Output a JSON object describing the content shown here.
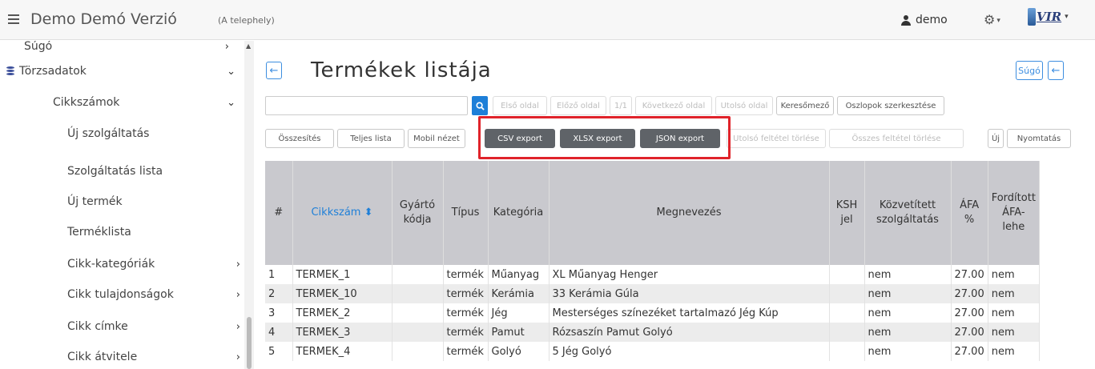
{
  "topbar": {
    "title": "Demo Demó Verzió",
    "subtitle": "(A telephely)",
    "user": "demo",
    "logo_text": "VIR"
  },
  "sidebar": {
    "items": [
      {
        "label": "Súgó"
      },
      {
        "label": "Törzsadatok"
      },
      {
        "label": "Cikkszámok"
      },
      {
        "label": "Új szolgáltatás"
      },
      {
        "label": "Szolgáltatás lista"
      },
      {
        "label": "Új termék"
      },
      {
        "label": "Terméklista"
      },
      {
        "label": "Cikk-kategóriák"
      },
      {
        "label": "Cikk tulajdonságok"
      },
      {
        "label": "Cikk címke"
      },
      {
        "label": "Cikk átvitele"
      }
    ]
  },
  "page": {
    "title": "Termékek listája",
    "help_label": "Súgó"
  },
  "search": {
    "value": "",
    "placeholder": ""
  },
  "toolbar_row1": {
    "first": "Első oldal",
    "prev": "Előző oldal",
    "page": "1/1",
    "next": "Következő oldal",
    "last": "Utolsó oldal",
    "search_field": "Keresőmező",
    "edit_columns": "Oszlopok szerkesztése"
  },
  "toolbar_row2": {
    "summary": "Összesítés",
    "full_list": "Teljes lista",
    "mobile": "Mobil nézet",
    "csv": "CSV export",
    "xlsx": "XLSX export",
    "json": "JSON export",
    "clear_last": "Utolsó feltétel törlése",
    "clear_all": "Összes feltétel törlése",
    "new": "Új",
    "print": "Nyomtatás"
  },
  "table": {
    "headers": {
      "num": "#",
      "code": "Cikkszám",
      "maker": "Gyártó kódja",
      "type": "Típus",
      "category": "Kategória",
      "name": "Megnevezés",
      "ksh": "KSH jel",
      "mediated": "Közvetített szolgáltatás",
      "vat": "ÁFA %",
      "reverse": "Fordított ÁFA-lehe"
    },
    "rows": [
      {
        "num": "1",
        "code": "TERMEK_1",
        "maker": "",
        "type": "termék",
        "category": "Műanyag",
        "name": "XL Műanyag Henger",
        "ksh": "",
        "mediated": "nem",
        "vat": "27.00",
        "reverse": "nem"
      },
      {
        "num": "2",
        "code": "TERMEK_10",
        "maker": "",
        "type": "termék",
        "category": "Kerámia",
        "name": "33 Kerámia Gúla",
        "ksh": "",
        "mediated": "nem",
        "vat": "27.00",
        "reverse": "nem"
      },
      {
        "num": "3",
        "code": "TERMEK_2",
        "maker": "",
        "type": "termék",
        "category": "Jég",
        "name": "Mesterséges színezéket tartalmazó Jég Kúp",
        "ksh": "",
        "mediated": "nem",
        "vat": "27.00",
        "reverse": "nem"
      },
      {
        "num": "4",
        "code": "TERMEK_3",
        "maker": "",
        "type": "termék",
        "category": "Pamut",
        "name": "Rózsaszín Pamut Golyó",
        "ksh": "",
        "mediated": "nem",
        "vat": "27.00",
        "reverse": "nem"
      },
      {
        "num": "5",
        "code": "TERMEK_4",
        "maker": "",
        "type": "termék",
        "category": "Golyó",
        "name": "5 Jég Golyó",
        "ksh": "",
        "mediated": "nem",
        "vat": "27.00",
        "reverse": "nem"
      }
    ]
  },
  "colors": {
    "accent": "#1e7fd8",
    "header_bg": "#c9c9ce",
    "highlight": "#e0232a",
    "export_btn": "#5f6368"
  },
  "icons": [
    "hamburger-icon",
    "user-icon",
    "gear-icon",
    "database-icon",
    "back-arrow-icon",
    "search-icon",
    "sort-icon",
    "chevron-down-icon",
    "chevron-right-icon"
  ]
}
